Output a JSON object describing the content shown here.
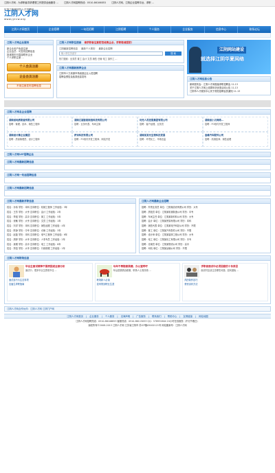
{
  "topbar": {
    "items": [
      "江阴人才网 - 为求职者寻求理想工作提供全面服务 ...",
      "江阴人才网招聘热线：0510-86106853",
      "江阴人才网，江阴企业招聘平台，求职 ..."
    ]
  },
  "header": {
    "slogan": "打造江阴最好的人才招聘网",
    "logo_name": "江阴人才网",
    "logo_url": "www.jyrcw.org"
  },
  "nav": [
    "江阴人才网首页",
    "企业招聘",
    "一句话招聘",
    "江阴招聘",
    "个人服务",
    "企业服务",
    "信息中心",
    "联系论坛"
  ],
  "left_panel": {
    "title": "江阴人才网企业服务",
    "lines": [
      "新企业用户免费注册",
      "企业会员：可发布招聘信息",
      "投递简历可直接联系企业",
      "个人求职注册 ..."
    ],
    "btn_personal": "个人会员注册",
    "btn_company": "企业会员注册",
    "btn_cannot_post": "不用注册发布招聘信息"
  },
  "search": {
    "title": "江阴人才网职位搜索",
    "title_alert": "请求职者注意防范收费企业，求职敬请提防！",
    "tabs": [
      "江阴最新招聘信息",
      "最新个人简历",
      "最新企业招聘"
    ],
    "placeholder": "输入职位关键字",
    "button": "搜 索",
    "hot": "热门搜索：业务员  普工  会计  文员  销售  仓管  电工  操作工  ..."
  },
  "mid_notice": {
    "title": "江阴人才网最新推荐企业",
    "lines": [
      "江阴市人力资源市场诚邀企业入驻招聘",
      "招聘会预告及各类信息发布"
    ]
  },
  "banner": {
    "line1": "江阴网站建设",
    "line2": "就选择江阴华夏网络"
  },
  "news": {
    "title": "江阴人才网信息公告",
    "items": [
      "新闻发布会：江阴人才网首届求职招聘会  11-13",
      "关于江阴人才网上线周年庆优惠活动公告  11-13",
      "江阴市人才服务中心关于规范招聘会的通知  11-13"
    ]
  },
  "famous": {
    "title": "江阴人才网名企业招聘",
    "items": [
      {
        "name": "湖南省地质勘查有限公司",
        "desc": "招聘：管理、技术、销售工程师"
      },
      {
        "name": "湖南江福智能制造科技有限公司",
        "desc": "招聘：业务代表、车间主管"
      },
      {
        "name": "利无人员控股集团有限公司",
        "desc": "招聘：客户经理、业务员"
      },
      {
        "name": "湖南省小贝网络...",
        "desc": "招聘：PO软件开发工程师"
      },
      {
        "name": "湖南省计算企业集团",
        "desc": "招聘：质量管理员、设计工程师"
      },
      {
        "name": "萨泽科技有限公司",
        "desc": "招聘：PO软件开发工程师、网站开发"
      },
      {
        "name": "湖南某某元生物科技发展",
        "desc": "招聘：环境化工、市场总监"
      },
      {
        "name": "金峰汽车配件公司",
        "desc": "招聘：机械技师、销售经理"
      }
    ]
  },
  "bars": [
    "江阴人才网VIP招聘企业",
    "江阴人才网最新招聘信息",
    "江阴人才网一句话招聘信息",
    "江阴人才网最新招聘信息"
  ],
  "personal": {
    "title": "江阴人才网最新求职信息",
    "rows": [
      "姓名：孙伟  学历：本科  意向职位：机械工程师  工作经验：3年",
      "姓名：王芳  学历：大专  意向职位：会计  工作经验：2年",
      "姓名：李强  学历：高中  意向职位：普工  工作经验：5年",
      "姓名：张敏  学历：大专  意向职位：文员  工作经验：1年",
      "姓名：刘洋  学历：本科  意向职位：销售经理  工作经验：4年",
      "姓名：陈静  学历：中专  意向职位：仓管  工作经验：3年",
      "姓名：赵磊  学历：本科  意向职位：电气工程师  工作经验：6年",
      "姓名：周婷  学历：大专  意向职位：人事专员  工作经验：2年",
      "姓名：吴刚  学历：高中  意向职位：电工  工作经验：8年",
      "姓名：郑霞  学历：大专  意向职位：行政助理  工作经验：1年"
    ]
  },
  "jobs": {
    "title": "江阴人才网最新企业招聘",
    "rows": [
      "招聘：外贸业务员  单位：江阴某纺织有限公司  学历：大专",
      "招聘：质检员  单位：江阴某机械制造公司  学历：中专",
      "招聘：车间主任  单位：江阴某新材料公司  学历：大专",
      "招聘：会计  单位：江阴某贸易有限公司  学历：本科",
      "招聘：销售代表  单位：江阴某电子科技公司  学历：不限",
      "招聘：普工  单位：江阴某汽车配件公司  学历：不限",
      "招聘：设计师  单位：江阴某装饰工程公司  学历：大专",
      "招聘：电工  单位：江阴某化工有限公司  学历：中专",
      "招聘：仓管员  单位：江阴某物流公司  学历：高中",
      "招聘：司机  单位：江阴某运输公司  学历：不限"
    ]
  },
  "edu": {
    "title": "江阴人才网职场信息",
    "cards": [
      {
        "head": "毕业生面试精神不振原因或全部分析",
        "body": "面试中，很多毕业生表现不佳 ...",
        "links": [
          "面试技巧与注意事项",
          "应届生求职指南"
        ]
      },
      {
        "head": "马年不再随意跳槽，办公室呼吁",
        "body": "年后是跳槽高峰期，职场人士需谨慎 ...",
        "links": [
          "职场新人必读",
          "如何规划职业生涯"
        ]
      },
      {
        "head": "求职者面试中必须回避的十条禁忌",
        "body": "面试时应该注意哪些问题，如何避免 ...",
        "links": [
          "简历制作技巧",
          "薪资谈判方法"
        ]
      }
    ]
  },
  "friend_links": "江阴人才网合作伙伴：江阴人才网  江阴门户网",
  "footer": {
    "nav": [
      "江阴人才网首页",
      "企业服务",
      "个人服务",
      "法律声明",
      "广告服务",
      "联系我们",
      "帮助中心",
      "友情链接",
      "网站地图"
    ],
    "lines": [
      "江阴人才网招聘热线：0510-86106853  客服热线：0510-86115053  QQ：578932604  24小时在线服务（不分节假日）",
      "版权所有©2008-2013 江阴人才网  江苏省江阴市  苏ICP备05002121号  网站备案号：江阴人才网"
    ]
  }
}
